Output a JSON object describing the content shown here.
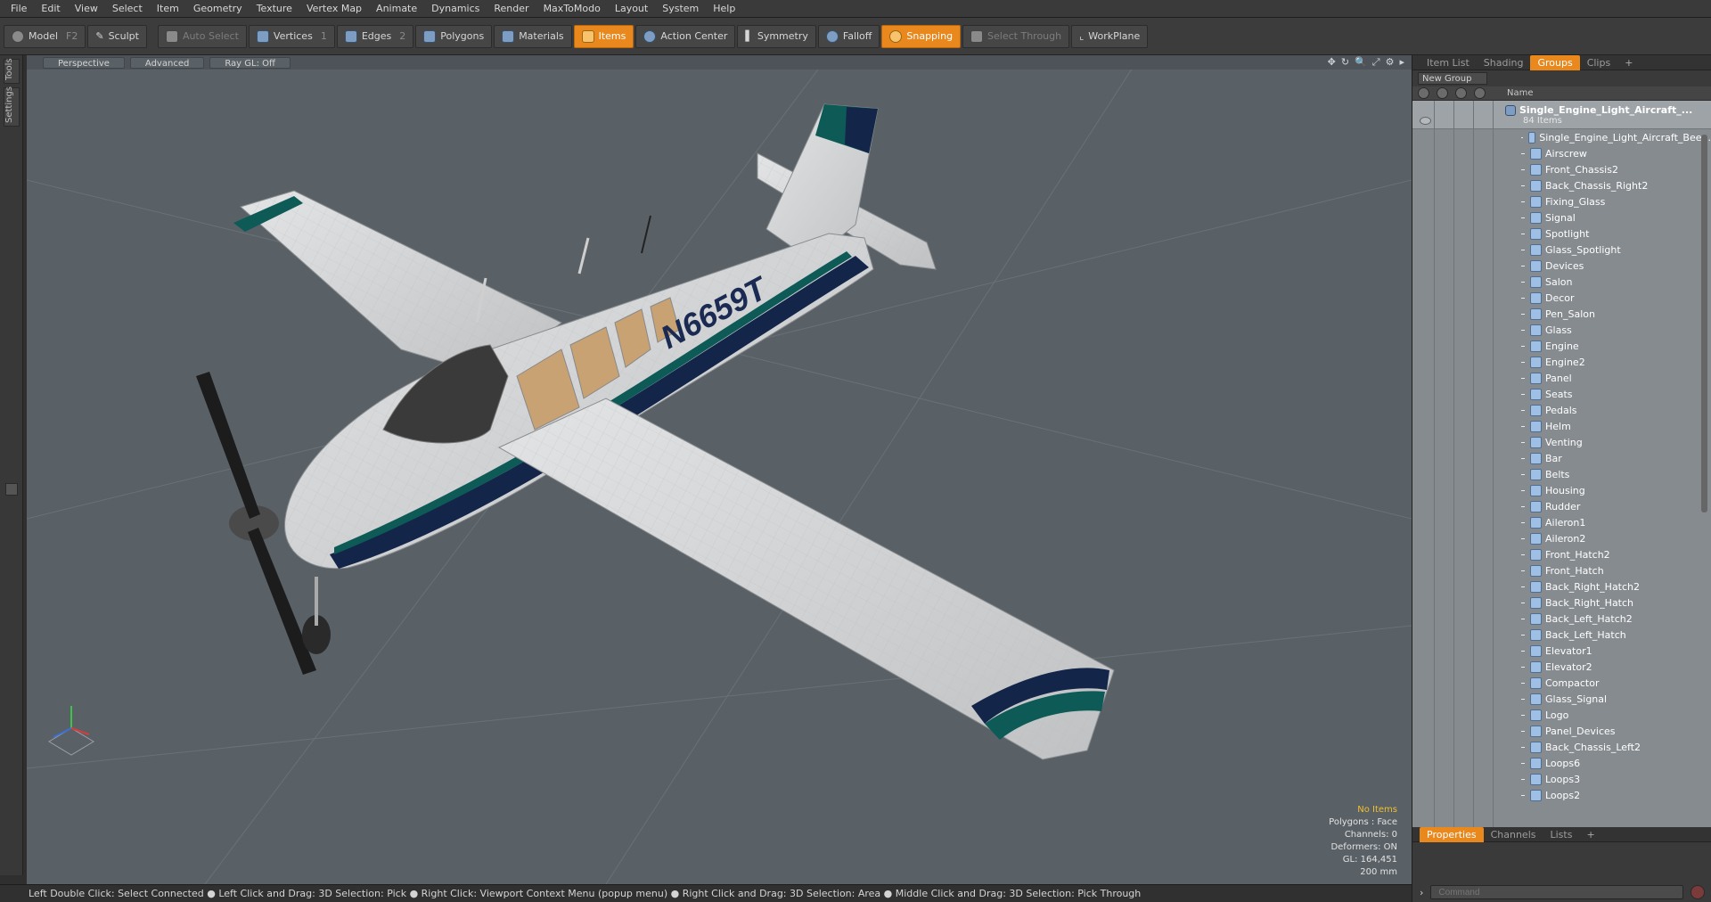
{
  "menu": [
    "File",
    "Edit",
    "View",
    "Select",
    "Item",
    "Geometry",
    "Texture",
    "Vertex Map",
    "Animate",
    "Dynamics",
    "Render",
    "MaxToModo",
    "Layout",
    "System",
    "Help"
  ],
  "toolbar": {
    "model": "Model",
    "model_key": "F2",
    "sculpt": "Sculpt",
    "auto_select": "Auto Select",
    "vertices": "Vertices",
    "vertices_key": "1",
    "edges": "Edges",
    "edges_key": "2",
    "polygons": "Polygons",
    "materials": "Materials",
    "items": "Items",
    "action_center": "Action Center",
    "symmetry": "Symmetry",
    "falloff": "Falloff",
    "snapping": "Snapping",
    "select_through": "Select Through",
    "workplane": "WorkPlane"
  },
  "left_tabs": [
    "Tools",
    "Settings"
  ],
  "viewport": {
    "perspective": "Perspective",
    "advanced": "Advanced",
    "raygl": "Ray GL: Off",
    "icons": [
      "✥",
      "↻",
      "🔍",
      "⤢",
      "⚙",
      "▸"
    ],
    "tail_number": "N6659T",
    "stats": {
      "no_items": "No Items",
      "polygons": "Polygons : Face",
      "channels": "Channels: 0",
      "deformers": "Deformers: ON",
      "gl": "GL: 164,451",
      "scale": "200 mm"
    }
  },
  "status": "Left Double Click: Select Connected ● Left Click and Drag: 3D Selection: Pick ● Right Click: Viewport Context Menu (popup menu) ● Right Click and Drag: 3D Selection: Area ● Middle Click and Drag: 3D Selection: Pick Through",
  "panel": {
    "tabs": [
      "Item List",
      "Shading",
      "Groups",
      "Clips",
      "+"
    ],
    "new_group": "New Group",
    "name_header": "Name",
    "root_name": "Single_Engine_Light_Aircraft_...",
    "root_count": "84 Items",
    "items": [
      "Single_Engine_Light_Aircraft_Bee...",
      "Airscrew",
      "Front_Chassis2",
      "Back_Chassis_Right2",
      "Fixing_Glass",
      "Signal",
      "Spotlight",
      "Glass_Spotlight",
      "Devices",
      "Salon",
      "Decor",
      "Pen_Salon",
      "Glass",
      "Engine",
      "Engine2",
      "Panel",
      "Seats",
      "Pedals",
      "Helm",
      "Venting",
      "Bar",
      "Belts",
      "Housing",
      "Rudder",
      "Aileron1",
      "Aileron2",
      "Front_Hatch2",
      "Front_Hatch",
      "Back_Right_Hatch2",
      "Back_Right_Hatch",
      "Back_Left_Hatch2",
      "Back_Left_Hatch",
      "Elevator1",
      "Elevator2",
      "Compactor",
      "Glass_Signal",
      "Logo",
      "Panel_Devices",
      "Back_Chassis_Left2",
      "Loops6",
      "Loops3",
      "Loops2"
    ],
    "bottom_tabs": [
      "Properties",
      "Channels",
      "Lists",
      "+"
    ],
    "command_placeholder": "Command"
  },
  "colors": {
    "accent": "#e8881d",
    "viewport_bg": "#596167",
    "stripe_teal": "#0d5a57",
    "stripe_navy": "#14254a"
  }
}
